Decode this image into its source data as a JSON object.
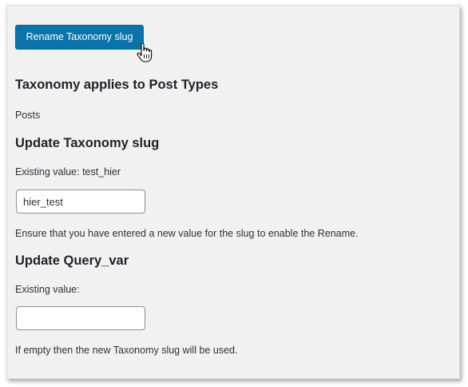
{
  "rename_button": {
    "label": "Rename Taxonomy slug"
  },
  "post_types": {
    "heading": "Taxonomy applies to Post Types",
    "value": "Posts"
  },
  "slug": {
    "heading": "Update Taxonomy slug",
    "existing": "Existing value: test_hier",
    "input_value": "hier_test",
    "help": "Ensure that you have entered a new value for the slug to enable the Rename."
  },
  "query_var": {
    "heading": "Update Query_var",
    "existing": "Existing value:",
    "input_value": "",
    "help": "If empty then the new Taxonomy slug will be used."
  },
  "colors": {
    "button_bg": "#0a73aa",
    "panel_bg": "#f1f1f1",
    "text": "#1d2327"
  },
  "icons": {
    "cursor": "hand-pointer-icon"
  }
}
